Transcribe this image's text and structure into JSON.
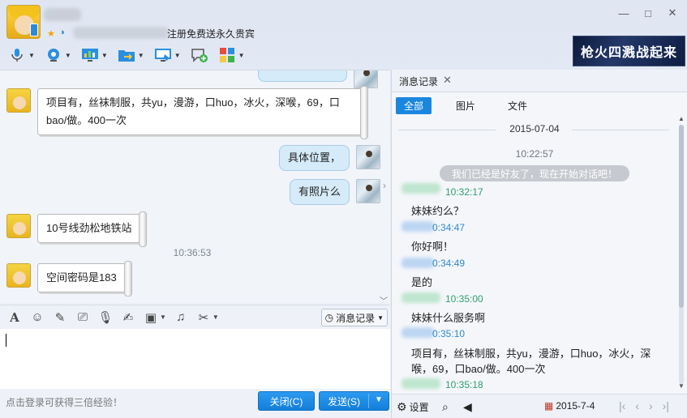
{
  "header": {
    "signature_text": "注册免费送永久贵宾",
    "ad_text": "枪火四溅战起来"
  },
  "window_controls": {
    "minimize": "—",
    "maximize": "□",
    "close": "✕"
  },
  "chat": {
    "messages": [
      {
        "side": "left",
        "text": "项目有，丝袜制服，共yu，漫游，口huo，冰火，深喉，69，口",
        "text2": "bao/做。400一次"
      },
      {
        "side": "right",
        "text": "具体位置，"
      },
      {
        "side": "right",
        "text": "有照片么"
      },
      {
        "side": "left",
        "text": "10号线劲松地铁站"
      },
      {
        "side": "time",
        "text": "10:36:53"
      },
      {
        "side": "left",
        "text": "空间密码是183"
      }
    ]
  },
  "input_toolbar": {
    "history_label": "消息记录"
  },
  "footer": {
    "login_tip": "点击登录可获得三倍经验！",
    "close_label": "关闭(C)",
    "send_label": "发送(S)"
  },
  "history": {
    "tab_label": "消息记录",
    "filters": [
      "全部",
      "图片",
      "文件"
    ],
    "date": "2015-07-04",
    "first_time": "10:22:57",
    "system_notice": "我们已经是好友了，现在开始对话吧！",
    "entries": [
      {
        "stamp": "10:32:17",
        "text": "妹妹约么？"
      },
      {
        "stamp": "0:34:47",
        "text": "你好啊！"
      },
      {
        "stamp": "0:34:49",
        "text": "是的"
      },
      {
        "stamp": "10:35:00",
        "text": "妹妹什么服务啊"
      },
      {
        "stamp": "0:35:10",
        "text": "项目有，丝袜制服，共yu，漫游，口huo，冰火，深",
        "text2": "喉，69，口bao/做。400一次"
      },
      {
        "stamp": "10:35:18",
        "text": ""
      }
    ],
    "settings_label": "设置",
    "footer_date": "2015-7-4"
  },
  "colors": {
    "accent": "#1a87df",
    "button": "#137fd9",
    "stamp": "#2c8ad0",
    "bubble_right": "#d5ebf9"
  },
  "icons": [
    "mic-icon",
    "camera-icon",
    "screen-share-icon",
    "folder-transfer-icon",
    "remote-desktop-icon",
    "add-chat-icon",
    "apps-icon",
    "font-icon",
    "emoji-icon",
    "magic-icon",
    "screenshot-icon",
    "voice-icon",
    "edit-icon",
    "image-icon",
    "music-icon",
    "scissors-icon",
    "clock-icon",
    "gear-icon",
    "search-icon",
    "speaker-icon",
    "calendar-icon"
  ]
}
